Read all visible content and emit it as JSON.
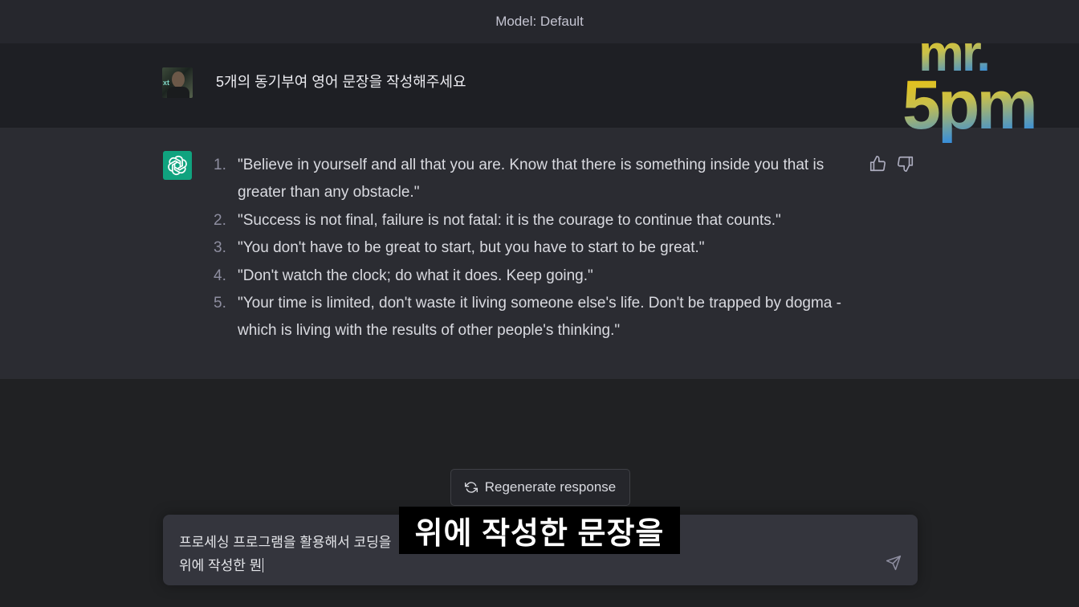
{
  "header": {
    "model_label": "Model: Default"
  },
  "user_message": {
    "text": "5개의 동기부여 영어 문장을 작성해주세요",
    "avatar_tag": "xt"
  },
  "assistant_message": {
    "items": [
      {
        "num": "1.",
        "text": "\"Believe in yourself and all that you are. Know that there is something inside you that is greater than any obstacle.\""
      },
      {
        "num": "2.",
        "text": "\"Success is not final, failure is not fatal: it is the courage to continue that counts.\""
      },
      {
        "num": "3.",
        "text": "\"You don't have to be great to start, but you have to start to be great.\""
      },
      {
        "num": "4.",
        "text": "\"Don't watch the clock; do what it does. Keep going.\""
      },
      {
        "num": "5.",
        "text": "\"Your time is limited, don't waste it living someone else's life. Don't be trapped by dogma - which is living with the results of other people's thinking.\""
      }
    ],
    "feedback_icons": [
      "thumbs-up-icon",
      "thumbs-down-icon"
    ]
  },
  "regenerate": {
    "label": "Regenerate response",
    "icon": "refresh-icon"
  },
  "composer": {
    "line1": "프로세싱 프로그램을 활용해서 코딩을",
    "line2": "위에 작성한 뭔",
    "send_icon": "send-icon"
  },
  "video_caption": {
    "text": "위에 작성한 문장을"
  },
  "watermark": {
    "line1": "mr.",
    "line2": "5pm"
  },
  "colors": {
    "assistant_avatar": "#10a37f",
    "page_bg": "#202123",
    "watermark_gold": "#f2c200",
    "watermark_blue": "#3a8fd8"
  }
}
